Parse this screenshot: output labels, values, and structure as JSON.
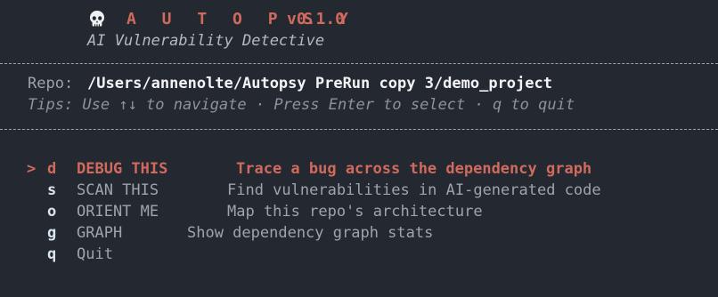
{
  "header": {
    "logo_icon": "skull-icon",
    "app_name": "A U T O P S Y",
    "version": "v0.1.0",
    "tagline": "AI Vulnerability Detective"
  },
  "info": {
    "repo_label": "Repo:",
    "repo_path": "/Users/annenolte/Autopsy PreRun copy 3/demo_project",
    "tips": "Tips: Use ↑↓ to navigate · Press Enter to select · q to quit"
  },
  "menu": {
    "cursor": ">",
    "selected_index": 0,
    "items": [
      {
        "key": "d",
        "label": "DEBUG THIS",
        "description": "Trace a bug across the dependency graph"
      },
      {
        "key": "s",
        "label": "SCAN THIS",
        "description": "Find vulnerabilities in AI-generated code"
      },
      {
        "key": "o",
        "label": "ORIENT ME",
        "description": "Map this repo's architecture"
      },
      {
        "key": "g",
        "label": "GRAPH",
        "description": "Show dependency graph stats"
      },
      {
        "key": "q",
        "label": "Quit",
        "description": ""
      }
    ]
  },
  "colors": {
    "background": "#242831",
    "accent": "#cf6a5c",
    "text": "#b8bcc4",
    "key": "#d8e5ea"
  }
}
